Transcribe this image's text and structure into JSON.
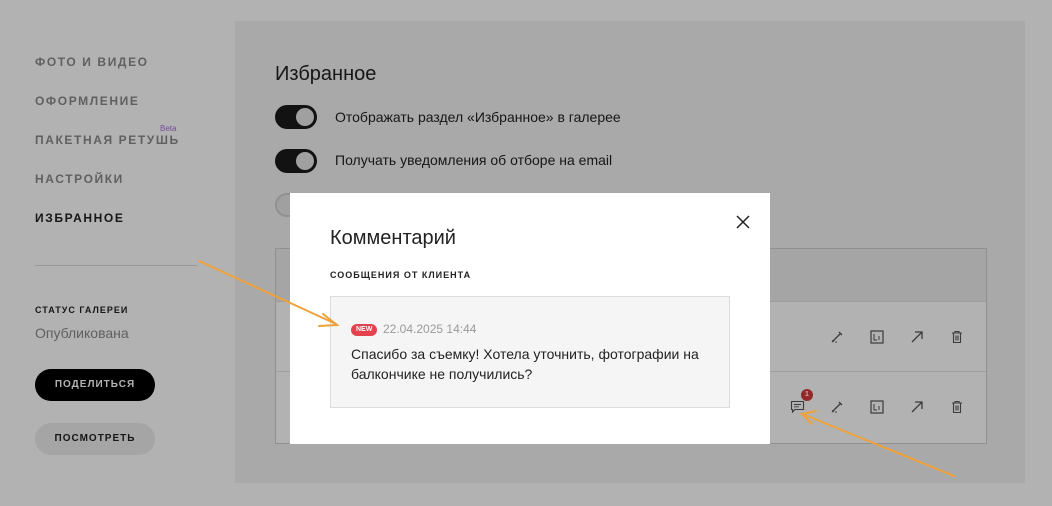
{
  "sidebar": {
    "items": [
      {
        "label": "ФОТО И ВИДЕО"
      },
      {
        "label": "ОФОРМЛЕНИЕ"
      },
      {
        "label": "ПАКЕТНАЯ РЕТУШЬ",
        "badge": "Beta"
      },
      {
        "label": "НАСТРОЙКИ"
      },
      {
        "label": "ИЗБРАННОЕ"
      }
    ],
    "status_label": "СТАТУС ГАЛЕРЕИ",
    "status_value": "Опубликована",
    "share_label": "ПОДЕЛИТЬСЯ",
    "view_label": "ПОСМОТРЕТЬ"
  },
  "content": {
    "title": "Избранное",
    "toggles": [
      {
        "label": "Отображать раздел «Избранное» в галерее",
        "on": true
      },
      {
        "label": "Получать уведомления об отборе на email",
        "on": true
      }
    ],
    "comment_badge_count": "1"
  },
  "modal": {
    "title": "Комментарий",
    "subtitle": "СООБЩЕНИЯ ОТ КЛИЕНТА",
    "message": {
      "badge": "NEW",
      "datetime": "22.04.2025 14:44",
      "text": "Спасибо за съемку! Хотела уточнить, фотографии на балкончике не получились?"
    }
  },
  "colors": {
    "arrow": "#f0a23a",
    "new_badge": "#e4424e",
    "beta": "#a56bd6"
  }
}
